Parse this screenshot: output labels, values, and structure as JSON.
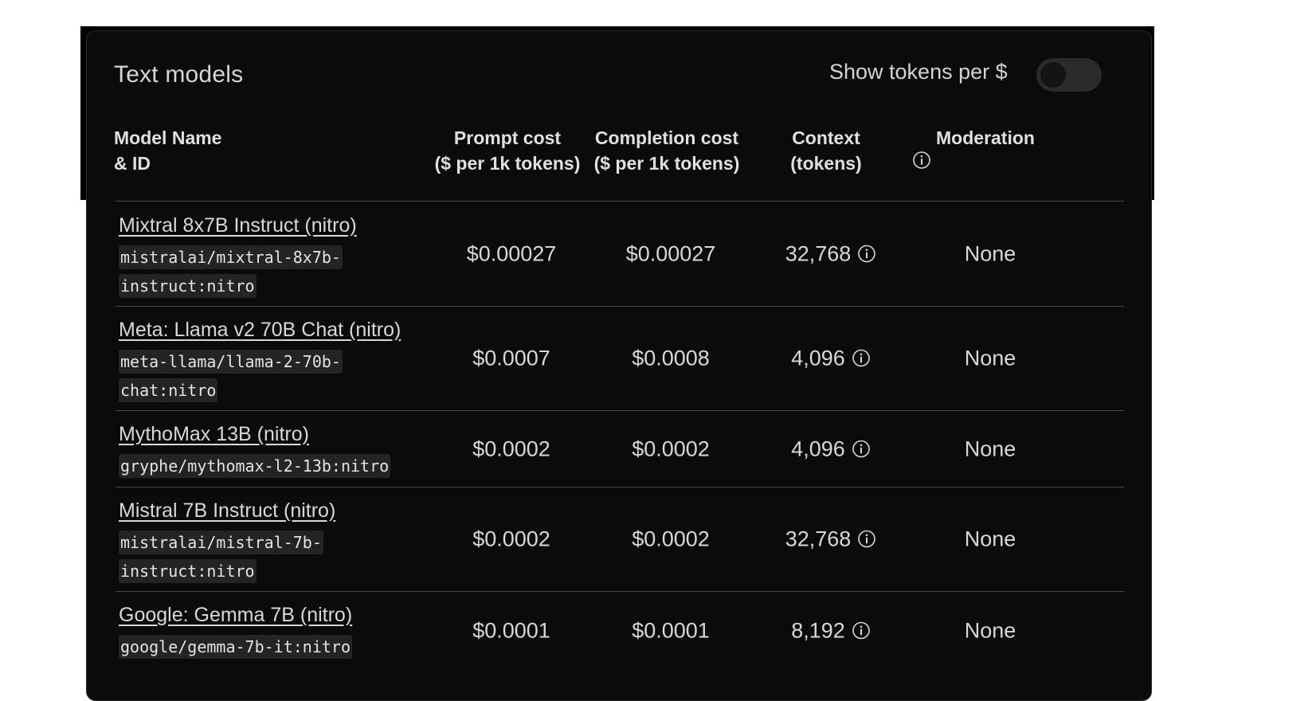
{
  "panel": {
    "title": "Text models",
    "toggle_label": "Show tokens per $",
    "toggle_on": false
  },
  "columns": {
    "model": [
      "Model Name",
      "& ID"
    ],
    "prompt": [
      "Prompt cost",
      "($ per 1k tokens)"
    ],
    "completion": [
      "Completion cost",
      "($ per 1k tokens)"
    ],
    "context": [
      "Context",
      "(tokens)"
    ],
    "moderation": [
      "Moderation"
    ]
  },
  "rows": [
    {
      "name": "Mixtral 8x7B Instruct (nitro)",
      "id_lines": [
        "mistralai/mixtral-8x7b-",
        "instruct:nitro"
      ],
      "prompt": "$0.00027",
      "completion": "$0.00027",
      "context": "32,768",
      "moderation": "None"
    },
    {
      "name": "Meta: Llama v2 70B Chat (nitro)",
      "id_lines": [
        "meta-llama/llama-2-70b-",
        "chat:nitro"
      ],
      "prompt": "$0.0007",
      "completion": "$0.0008",
      "context": "4,096",
      "moderation": "None"
    },
    {
      "name": "MythoMax 13B (nitro)",
      "id_lines": [
        "gryphe/mythomax-l2-13b:nitro"
      ],
      "prompt": "$0.0002",
      "completion": "$0.0002",
      "context": "4,096",
      "moderation": "None"
    },
    {
      "name": "Mistral 7B Instruct (nitro)",
      "id_lines": [
        "mistralai/mistral-7b-",
        "instruct:nitro"
      ],
      "prompt": "$0.0002",
      "completion": "$0.0002",
      "context": "32,768",
      "moderation": "None"
    },
    {
      "name": "Google: Gemma 7B (nitro)",
      "id_lines": [
        "google/gemma-7b-it:nitro"
      ],
      "prompt": "$0.0001",
      "completion": "$0.0001",
      "context": "8,192",
      "moderation": "None"
    }
  ],
  "icons": {
    "info": "info-circle-icon"
  }
}
